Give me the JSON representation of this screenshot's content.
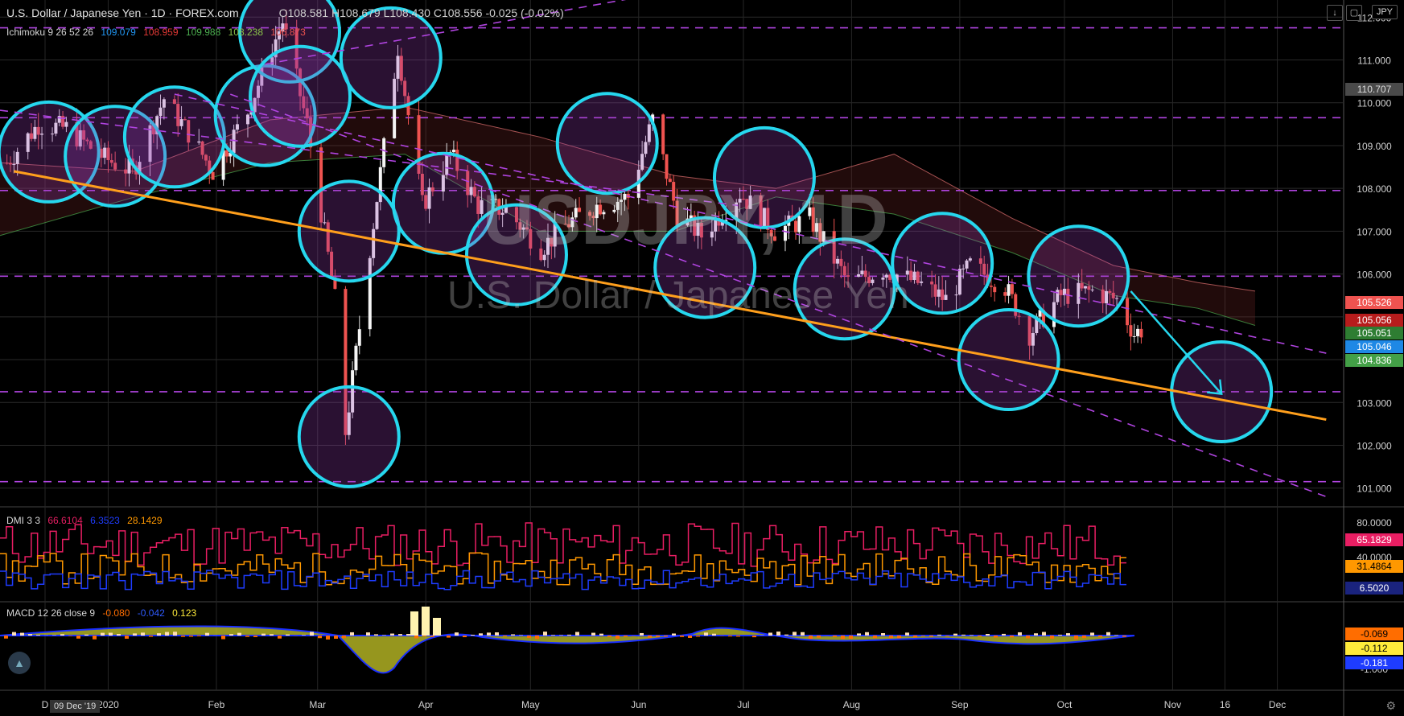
{
  "header": {
    "title": "U.S. Dollar / Japanese Yen · 1D · FOREX.com",
    "ohlc": "O108.581 H108.679 L108.430 C108.556 -0.025 (-0.02%)",
    "ichimoku": "Ichimoku 9 26 52 26",
    "ichimoku_values": [
      "109.079",
      "108.959",
      "109.988",
      "108.238",
      "106.873"
    ],
    "ichimoku_colors": [
      "#2196f3",
      "#e53935",
      "#4caf50",
      "#8bc34a",
      "#ef5350"
    ]
  },
  "currency_pill": "JPY",
  "watermark": {
    "symbol": "USDJPY, 1D",
    "name": "U.S. Dollar / Japanese Yen"
  },
  "dmi": {
    "label": "DMI 3 3",
    "values": [
      "66.6104",
      "6.3523",
      "28.1429"
    ],
    "colors": [
      "#e91e63",
      "#1e3cff",
      "#ff9800"
    ]
  },
  "macd": {
    "label": "MACD 12 26 close 9",
    "values": [
      "-0.080",
      "-0.042",
      "0.123"
    ],
    "colors": [
      "#ff6d00",
      "#2f5bff",
      "#ffeb3b"
    ]
  },
  "date_tooltip": "09 Dec '19",
  "price_axis": [
    "112.000",
    "111.000",
    "110.000",
    "109.000",
    "108.000",
    "107.000",
    "106.000",
    "105.000",
    "104.000",
    "103.000",
    "102.000",
    "101.000"
  ],
  "price_badges": [
    {
      "text": "110.707",
      "bg": "#4a4a4a",
      "fg": "#ddd"
    },
    {
      "text": "105.526",
      "bg": "#ef5350",
      "fg": "#fff"
    },
    {
      "text": "105.056",
      "bg": "#b71c1c",
      "fg": "#fff"
    },
    {
      "text": "105.051",
      "bg": "#2e7d32",
      "fg": "#fff"
    },
    {
      "text": "105.046",
      "bg": "#1e88e5",
      "fg": "#fff"
    },
    {
      "text": "104.836",
      "bg": "#43a047",
      "fg": "#fff"
    }
  ],
  "dmi_axis": [
    "80.0000",
    "40.0000"
  ],
  "dmi_badges": [
    {
      "text": "65.1829",
      "bg": "#e91e63",
      "fg": "#fff"
    },
    {
      "text": "31.4864",
      "bg": "#ff9800",
      "fg": "#000"
    },
    {
      "text": "6.5020",
      "bg": "#1a237e",
      "fg": "#fff"
    }
  ],
  "macd_axis": [
    "-1.000"
  ],
  "macd_badges": [
    {
      "text": "-0.069",
      "bg": "#ff6d00",
      "fg": "#000"
    },
    {
      "text": "-0.112",
      "bg": "#ffeb3b",
      "fg": "#000"
    },
    {
      "text": "-0.181",
      "bg": "#1e3cff",
      "fg": "#fff"
    }
  ],
  "time_axis": [
    "D",
    "2020",
    "Feb",
    "Mar",
    "Apr",
    "May",
    "Jun",
    "Jul",
    "Aug",
    "Sep",
    "Oct",
    "Nov",
    "16",
    "Dec"
  ],
  "chart_data": {
    "type": "candlestick",
    "title": "U.S. Dollar / Japanese Yen · 1D · FOREX.com",
    "ylim": [
      100.6,
      112.4
    ],
    "grid": true,
    "key_price_levels": [
      111.75,
      109.65,
      107.95,
      105.95,
      103.25,
      101.15
    ],
    "trendline_support": {
      "from": [
        "2019-12-05",
        108.4
      ],
      "to": [
        "2020-12-15",
        102.6
      ]
    },
    "channel_upper": {
      "from": [
        "2020-01-20",
        110.2
      ],
      "to": [
        "2020-12-15",
        104.15
      ]
    },
    "projection_arrow": {
      "from": [
        "2020-10-20",
        105.6
      ],
      "to": [
        "2020-11-15",
        103.2
      ]
    },
    "circles": [
      {
        "date": "2019-12-15",
        "price": 108.85
      },
      {
        "date": "2020-01-03",
        "price": 108.75
      },
      {
        "date": "2020-01-20",
        "price": 109.2
      },
      {
        "date": "2020-02-15",
        "price": 109.7
      },
      {
        "date": "2020-02-22",
        "price": 111.65
      },
      {
        "date": "2020-02-25",
        "price": 110.15
      },
      {
        "date": "2020-03-10",
        "price": 107.0
      },
      {
        "date": "2020-03-10",
        "price": 102.2
      },
      {
        "date": "2020-03-22",
        "price": 111.05
      },
      {
        "date": "2020-04-06",
        "price": 107.65
      },
      {
        "date": "2020-04-27",
        "price": 106.45
      },
      {
        "date": "2020-05-23",
        "price": 109.05
      },
      {
        "date": "2020-06-20",
        "price": 106.15
      },
      {
        "date": "2020-07-07",
        "price": 108.25
      },
      {
        "date": "2020-07-30",
        "price": 105.65
      },
      {
        "date": "2020-08-27",
        "price": 106.25
      },
      {
        "date": "2020-09-15",
        "price": 104.0
      },
      {
        "date": "2020-10-05",
        "price": 105.95
      },
      {
        "date": "2020-11-15",
        "price": 103.25
      }
    ],
    "close_path": [
      [
        "2019-12-03",
        108.6
      ],
      [
        "2019-12-12",
        109.5
      ],
      [
        "2019-12-20",
        109.4
      ],
      [
        "2019-12-31",
        108.7
      ],
      [
        "2020-01-08",
        108.4
      ],
      [
        "2020-01-17",
        110.1
      ],
      [
        "2020-01-24",
        109.3
      ],
      [
        "2020-01-31",
        108.4
      ],
      [
        "2020-02-10",
        109.8
      ],
      [
        "2020-02-20",
        111.9
      ],
      [
        "2020-02-27",
        109.5
      ],
      [
        "2020-03-06",
        105.4
      ],
      [
        "2020-03-09",
        102.3
      ],
      [
        "2020-03-16",
        106.6
      ],
      [
        "2020-03-24",
        111.3
      ],
      [
        "2020-03-31",
        107.6
      ],
      [
        "2020-04-08",
        108.8
      ],
      [
        "2020-04-16",
        107.6
      ],
      [
        "2020-04-24",
        107.5
      ],
      [
        "2020-05-04",
        106.6
      ],
      [
        "2020-05-12",
        107.2
      ],
      [
        "2020-05-20",
        107.6
      ],
      [
        "2020-05-29",
        107.8
      ],
      [
        "2020-06-05",
        109.6
      ],
      [
        "2020-06-12",
        107.4
      ],
      [
        "2020-06-19",
        106.9
      ],
      [
        "2020-06-30",
        107.9
      ],
      [
        "2020-07-10",
        107.0
      ],
      [
        "2020-07-20",
        107.3
      ],
      [
        "2020-07-31",
        105.8
      ],
      [
        "2020-08-10",
        106.1
      ],
      [
        "2020-08-20",
        105.8
      ],
      [
        "2020-08-28",
        105.4
      ],
      [
        "2020-09-04",
        106.2
      ],
      [
        "2020-09-14",
        105.7
      ],
      [
        "2020-09-21",
        104.6
      ],
      [
        "2020-09-30",
        105.5
      ],
      [
        "2020-10-09",
        105.6
      ],
      [
        "2020-10-16",
        105.4
      ],
      [
        "2020-10-21",
        104.6
      ],
      [
        "2020-10-23",
        104.7
      ]
    ],
    "kumo_upper": [
      [
        0,
        108.6
      ],
      [
        40,
        108.4
      ],
      [
        80,
        109.6
      ],
      [
        120,
        109.9
      ],
      [
        160,
        109.2
      ],
      [
        200,
        108.3
      ],
      [
        230,
        108.0
      ],
      [
        265,
        108.8
      ],
      [
        300,
        107.3
      ],
      [
        330,
        106.2
      ],
      [
        355,
        105.8
      ],
      [
        372,
        105.6
      ]
    ],
    "kumo_lower": [
      [
        0,
        106.9
      ],
      [
        40,
        107.8
      ],
      [
        80,
        108.6
      ],
      [
        120,
        108.8
      ],
      [
        160,
        107.0
      ],
      [
        200,
        107.0
      ],
      [
        230,
        107.8
      ],
      [
        265,
        107.4
      ],
      [
        300,
        106.5
      ],
      [
        330,
        105.5
      ],
      [
        355,
        105.2
      ],
      [
        372,
        104.8
      ]
    ]
  }
}
